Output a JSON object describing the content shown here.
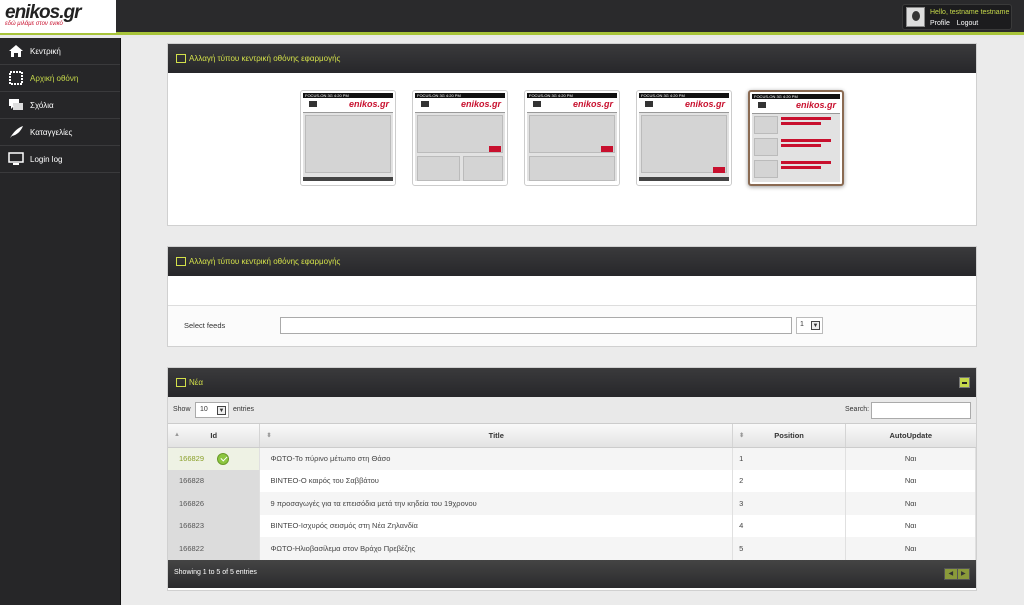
{
  "brand": {
    "logo_main": "enikos",
    "logo_tld": ".gr",
    "tagline": "εδώ μιλάμε στον ενικό"
  },
  "user": {
    "greeting": "Hello, testname testname",
    "profile": "Profile",
    "logout": "Logout"
  },
  "sidebar": {
    "items": [
      {
        "label": "Κεντρική",
        "icon": "home-icon"
      },
      {
        "label": "Αρχική οθόνη",
        "icon": "screen-frame-icon",
        "active": true
      },
      {
        "label": "Σχόλια",
        "icon": "comments-icon"
      },
      {
        "label": "Καταγγελίες",
        "icon": "feather-icon"
      },
      {
        "label": "Login log",
        "icon": "monitor-icon"
      }
    ]
  },
  "panel1": {
    "title": "Αλλαγή τύπου κεντρική οθόνης εφαρμογής",
    "selected_theme_index": 4,
    "phone": {
      "status": "FOCUS-ON 3G 4:20 PM",
      "logo": "enikos.gr"
    }
  },
  "panel2": {
    "title": "Αλλαγή τύπου κεντρική οθόνης εφαρμογής",
    "feeds_label": "Select feeds",
    "feeds_value": "",
    "feeds_select": "1"
  },
  "news": {
    "title": "Νέα",
    "show_label": "Show",
    "show_value": "10",
    "entries_label": "entries",
    "search_label": "Search:",
    "columns": [
      "Id",
      "Title",
      "Position",
      "AutoUpdate"
    ],
    "rows": [
      {
        "id": "166829",
        "title": "ΦΩΤΟ-Το πύρινο μέτωπο στη Θάσο",
        "position": "1",
        "auto": "Ναι"
      },
      {
        "id": "166828",
        "title": "ΒΙΝΤΕΟ-Ο καιρός του Σαββάτου",
        "position": "2",
        "auto": "Ναι"
      },
      {
        "id": "166826",
        "title": "9 προσαγωγές για τα επεισόδια μετά την κηδεία του 19χρονου",
        "position": "3",
        "auto": "Ναι"
      },
      {
        "id": "166823",
        "title": "ΒΙΝΤΕΟ-Ισχυρός σεισμός στη Νέα Ζηλανδία",
        "position": "4",
        "auto": "Ναι"
      },
      {
        "id": "166822",
        "title": "ΦΩΤΟ-Ηλιοβασίλεμα στον Βράχο Πρεβέζης",
        "position": "5",
        "auto": "Ναι"
      }
    ],
    "footer_info": "Showing 1 to 5 of 5 entries"
  },
  "colors": {
    "accent": "#c6d84a",
    "brand_red": "#c8102e",
    "dark": "#2a2a2c"
  }
}
